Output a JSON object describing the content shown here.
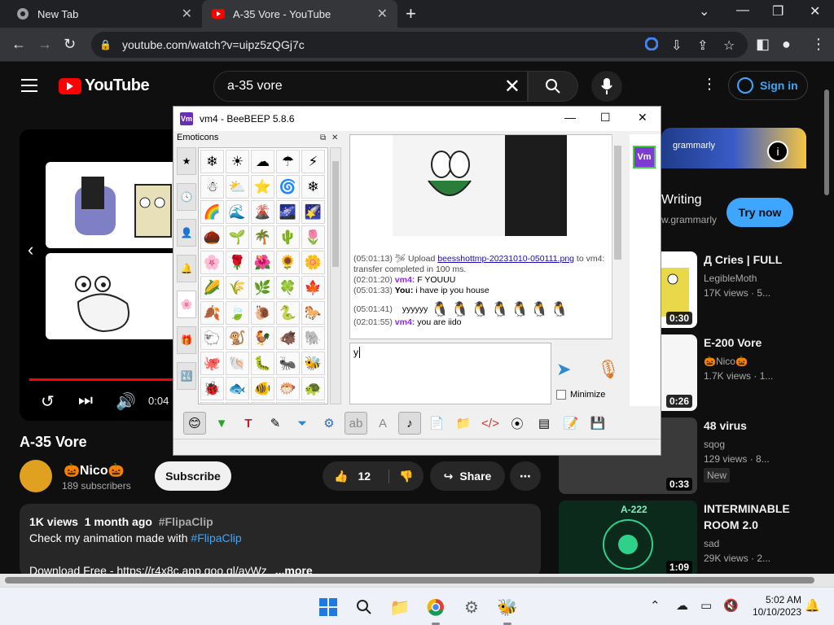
{
  "browser": {
    "tabs": [
      {
        "title": "New Tab",
        "icon": "chrome-icon"
      },
      {
        "title": "A-35 Vore - YouTube",
        "icon": "youtube-icon"
      }
    ],
    "url": "youtube.com/watch?v=uipz5zQGj7c"
  },
  "youtube": {
    "logo_text": "YouTube",
    "search_value": "a-35 vore",
    "signin_label": "Sign in",
    "player": {
      "time": "0:04"
    },
    "video_title": "A-35 Vore",
    "channel_name": "🎃Nico🎃",
    "subscribers": "189 subscribers",
    "subscribe_label": "Subscribe",
    "likes": "12",
    "share_label": "Share",
    "description": {
      "views": "1K views",
      "ago": "1 month ago",
      "hashtag": "#FlipaClip",
      "line1_prefix": "Check my animation made with ",
      "line1_tag": "#FlipaClip",
      "line3": "Download Free - https://r4x8c.app.goo.gl/avWz",
      "more": "...more"
    },
    "ad": {
      "brand": "grammarly",
      "writing": "Writing",
      "domain": "w.grammarly",
      "cta": "Try now"
    },
    "recommendations": [
      {
        "title": "Д Cries | FULL",
        "channel": "LegibleMoth",
        "views": "17K views · 5...",
        "duration": "0:30"
      },
      {
        "title": "E-200 Vore",
        "channel": "🎃Nico🎃",
        "views": "1.7K views · 1...",
        "duration": "0:26"
      },
      {
        "title": "48 virus",
        "channel": "sqog",
        "views": "129 views · 8...",
        "badge": "New",
        "duration": "0:33"
      },
      {
        "title": "INTERMINABLE ROOM 2.0",
        "channel": "sad",
        "views": "29K views · 2...",
        "duration": "1:09",
        "thumb_text": "A-222"
      }
    ]
  },
  "beebeep": {
    "title": "vm4 - BeeBEEP 5.8.6",
    "app_icon_text": "Vm",
    "emoticons_label": "Emoticons",
    "emoticons": [
      "❄",
      "☀",
      "☁",
      "☂",
      "⚡",
      "☃",
      "⛅",
      "⭐",
      "🌀",
      "❄",
      "🌈",
      "🌊",
      "🌋",
      "🌌",
      "🌠",
      "🌰",
      "🌱",
      "🌴",
      "🌵",
      "🌷",
      "🌸",
      "🌹",
      "🌺",
      "🌻",
      "🌼",
      "🌽",
      "🌾",
      "🌿",
      "🍀",
      "🍁",
      "🍂",
      "🍃",
      "🐌",
      "🐍",
      "🐎",
      "🐑",
      "🐒",
      "🐓",
      "🐗",
      "🐘",
      "🐙",
      "🐚",
      "🐛",
      "🐜",
      "🐝",
      "🐞",
      "🐟",
      "🐠",
      "🐡",
      "🐢",
      "🐣",
      "🐤",
      "🐥",
      "🐦",
      "🐧"
    ],
    "messages": {
      "m1_ts": "(05:01:13)",
      "m1_text_a": " Upload ",
      "m1_link": "beesshottmp-20231010-050111.png",
      "m1_text_b": " to vm4: transfer completed in 100 ms.",
      "m2_ts": "(02:01:20)",
      "m2_user": "vm4:",
      "m2_text": " F YOUUU",
      "m3_ts": "(05:01:33)",
      "m3_user": "You:",
      "m3_text": " i have ip you house",
      "m4_ts": "(05:01:41)",
      "m4_text": "yyyyyy",
      "m4_emoji": "🐧🐧🐧🐧🐧🐧🐧",
      "m5_ts": "(02:01:55)",
      "m5_user": "vm4:",
      "m5_text": " you are iido"
    },
    "input_value": "y",
    "minimize_label": "Minimize",
    "user_badge": "Vm"
  },
  "taskbar": {
    "time": "5:02 AM",
    "date": "10/10/2023"
  },
  "colors": {
    "yt_bg": "#0f0f0f",
    "yt_red": "#ff0000",
    "link_blue": "#3ea6ff",
    "bee_purple": "#8a2be2"
  }
}
